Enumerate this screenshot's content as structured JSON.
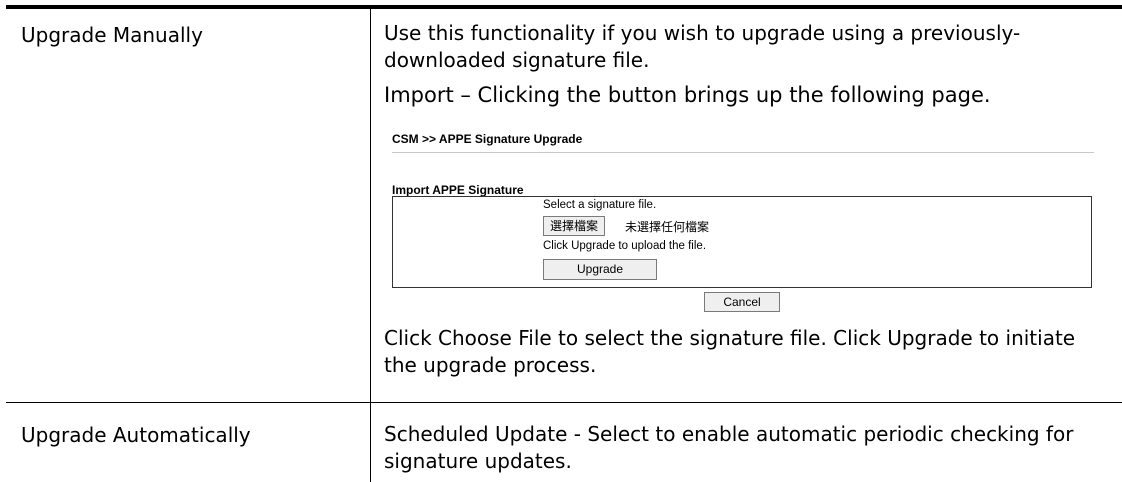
{
  "rows": [
    {
      "label": "Upgrade Manually",
      "intro": "Use this functionality if you wish to upgrade using a previously-downloaded signature file.",
      "import_term": "Import",
      "import_text": " – Clicking the button brings up the following page.",
      "outro_1": "Click ",
      "choose_term": "Choose File",
      "outro_2": " to select the signature file. Click ",
      "upgrade_term": "Upgrade",
      "outro_3": " to initiate the upgrade process."
    },
    {
      "label": "Upgrade Automatically",
      "scheduled_term": "Scheduled Update",
      "scheduled_text": " - Select to enable automatic periodic checking for signature updates."
    }
  ],
  "embedded_page": {
    "breadcrumb": "CSM >> APPE Signature Upgrade",
    "section_title": "Import APPE Signature",
    "select_prompt": "Select a signature file.",
    "choose_file_button": "選擇檔案",
    "no_file_text": "未選擇任何檔案",
    "upload_hint": "Click Upgrade to upload the file.",
    "upgrade_button": "Upgrade",
    "cancel_button": "Cancel"
  }
}
